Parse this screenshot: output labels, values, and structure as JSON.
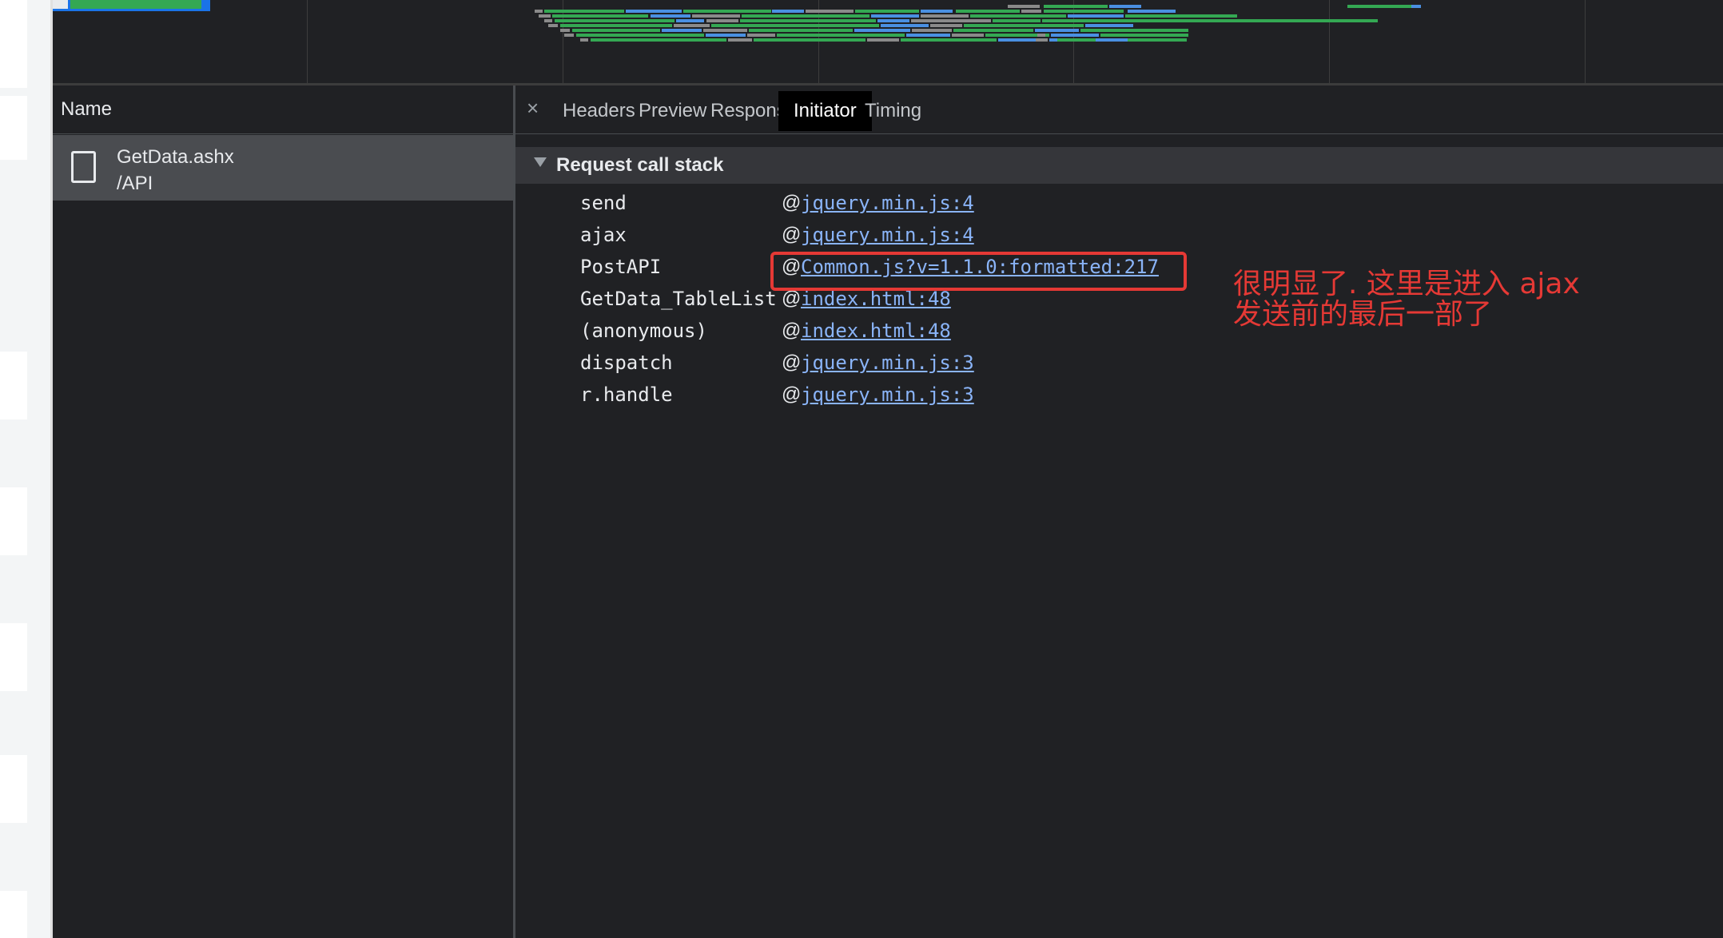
{
  "name_panel": {
    "header": "Name",
    "request": {
      "name": "GetData.ashx",
      "path": "/API",
      "icon": "document-icon"
    }
  },
  "details": {
    "close_icon": "×",
    "tabs": [
      {
        "label": "Headers",
        "active": false
      },
      {
        "label": "Preview",
        "active": false
      },
      {
        "label": "Response",
        "active": false
      },
      {
        "label": "Initiator",
        "active": true
      },
      {
        "label": "Timing",
        "active": false
      }
    ],
    "section_title": "Request call stack",
    "frames": [
      {
        "fn": "send",
        "at": "@",
        "link": "jquery.min.js:4"
      },
      {
        "fn": "ajax",
        "at": "@",
        "link": "jquery.min.js:4"
      },
      {
        "fn": "PostAPI",
        "at": "@",
        "link": "Common.js?v=1.1.0:formatted:217"
      },
      {
        "fn": "GetData_TableList",
        "at": "@",
        "link": "index.html:48"
      },
      {
        "fn": "(anonymous)",
        "at": "@",
        "link": "index.html:48"
      },
      {
        "fn": "dispatch",
        "at": "@",
        "link": "jquery.min.js:3"
      },
      {
        "fn": "r.handle",
        "at": "@",
        "link": "jquery.min.js:3"
      }
    ]
  },
  "annotation": {
    "line1": "很明显了. 这里是进入 ajax",
    "line2": "发送前的最后一部了",
    "color": "#e53935"
  },
  "colors": {
    "background": "#202124",
    "link": "#8ab4f8",
    "selected_row": "#4a4c50",
    "active_tab": "#000000"
  }
}
